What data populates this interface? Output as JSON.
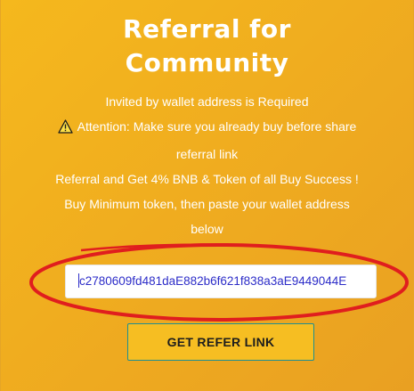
{
  "header": {
    "title_line1": "Referral for",
    "title_line2": "Community"
  },
  "info": {
    "line1": "Invited by wallet address is Required",
    "line2": "Attention: Make sure you already buy before share",
    "line3": "referral link",
    "line4": "Referral and Get 4% BNB & Token of all Buy Success !",
    "line5": "Buy Minimum token, then paste your wallet address",
    "line6": "below",
    "warning_icon": "warning-triangle-icon"
  },
  "wallet_field": {
    "value": "c2780609fd481daE882b6f621f838a3aE9449044E"
  },
  "refer_button": {
    "label": "GET REFER LINK"
  },
  "colors": {
    "background": "#f0ad1f",
    "button": "#f6be22",
    "button_border": "#1f8f8f",
    "annotation_circle": "#e01e1e",
    "input_text": "#2c2cc8"
  }
}
